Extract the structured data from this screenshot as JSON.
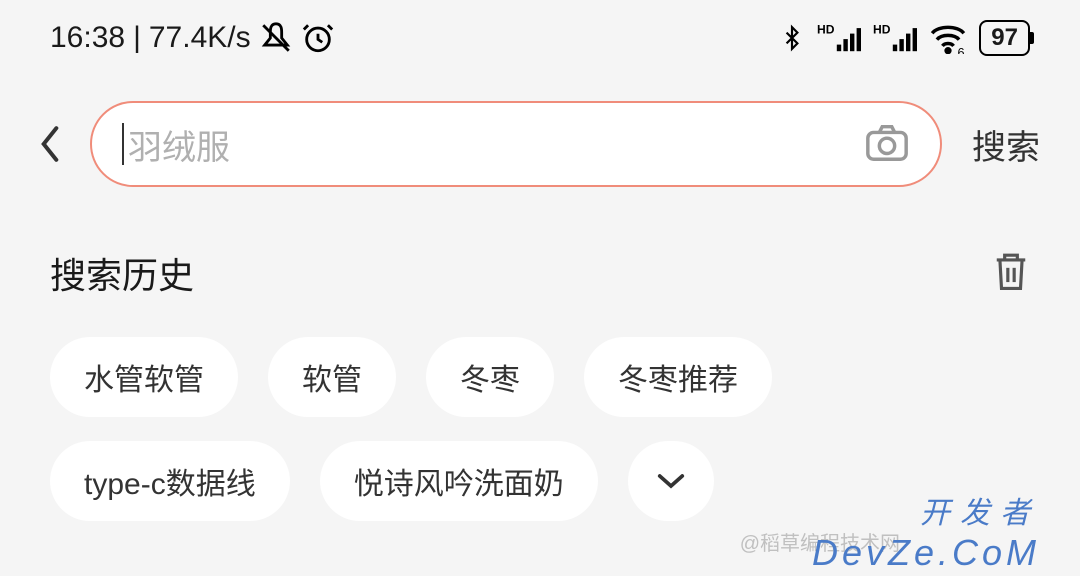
{
  "status": {
    "time": "16:38",
    "separator": "|",
    "speed": "77.4K/s",
    "battery": "97"
  },
  "search": {
    "placeholder": "羽绒服",
    "button": "搜索"
  },
  "history": {
    "title": "搜索历史",
    "tags": [
      "水管软管",
      "软管",
      "冬枣",
      "冬枣推荐",
      "type-c数据线",
      "悦诗风吟洗面奶"
    ]
  },
  "watermark": {
    "small": "@稻草编程技术网",
    "brand_pre": "开发者",
    "brand": "DevZe.CoM"
  }
}
